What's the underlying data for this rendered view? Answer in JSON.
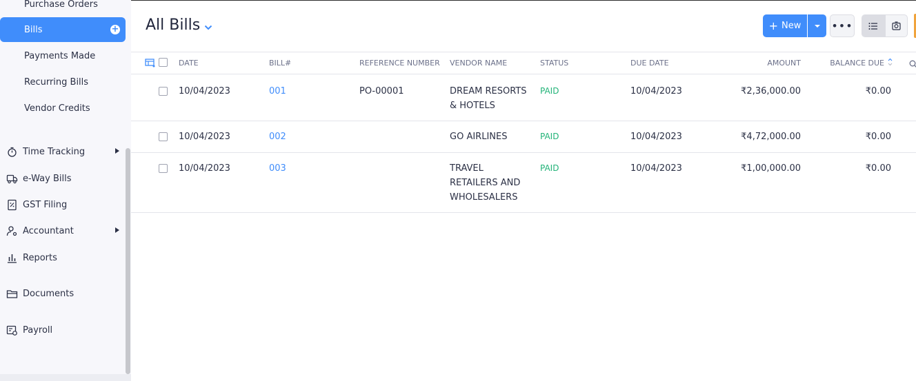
{
  "sidebar": {
    "purchase_orders": "Purchase Orders",
    "bills": "Bills",
    "payments_made": "Payments Made",
    "recurring_bills": "Recurring Bills",
    "vendor_credits": "Vendor Credits",
    "time_tracking": "Time Tracking",
    "eway_bills": "e-Way Bills",
    "gst_filing": "GST Filing",
    "accountant": "Accountant",
    "reports": "Reports",
    "documents": "Documents",
    "payroll": "Payroll"
  },
  "header": {
    "title": "All Bills",
    "new_label": "New",
    "more_label": "•••"
  },
  "table": {
    "columns": {
      "date": "DATE",
      "bill_no": "BILL#",
      "reference": "REFERENCE NUMBER",
      "vendor": "VENDOR NAME",
      "status": "STATUS",
      "due_date": "DUE DATE",
      "amount": "AMOUNT",
      "balance_due": "BALANCE DUE"
    },
    "rows": [
      {
        "date": "10/04/2023",
        "bill_no": "001",
        "reference": "PO-00001",
        "vendor": "DREAM RESORTS & HOTELS",
        "status": "PAID",
        "due_date": "10/04/2023",
        "amount": "₹2,36,000.00",
        "balance_due": "₹0.00"
      },
      {
        "date": "10/04/2023",
        "bill_no": "002",
        "reference": "",
        "vendor": "GO AIRLINES",
        "status": "PAID",
        "due_date": "10/04/2023",
        "amount": "₹4,72,000.00",
        "balance_due": "₹0.00"
      },
      {
        "date": "10/04/2023",
        "bill_no": "003",
        "reference": "",
        "vendor": "TRAVEL RETAILERS AND WHOLESALERS",
        "status": "PAID",
        "due_date": "10/04/2023",
        "amount": "₹1,00,000.00",
        "balance_due": "₹0.00"
      }
    ]
  },
  "colors": {
    "accent": "#408dfb",
    "paid": "#22b378",
    "sidebar_bg": "#f7f7fb"
  }
}
